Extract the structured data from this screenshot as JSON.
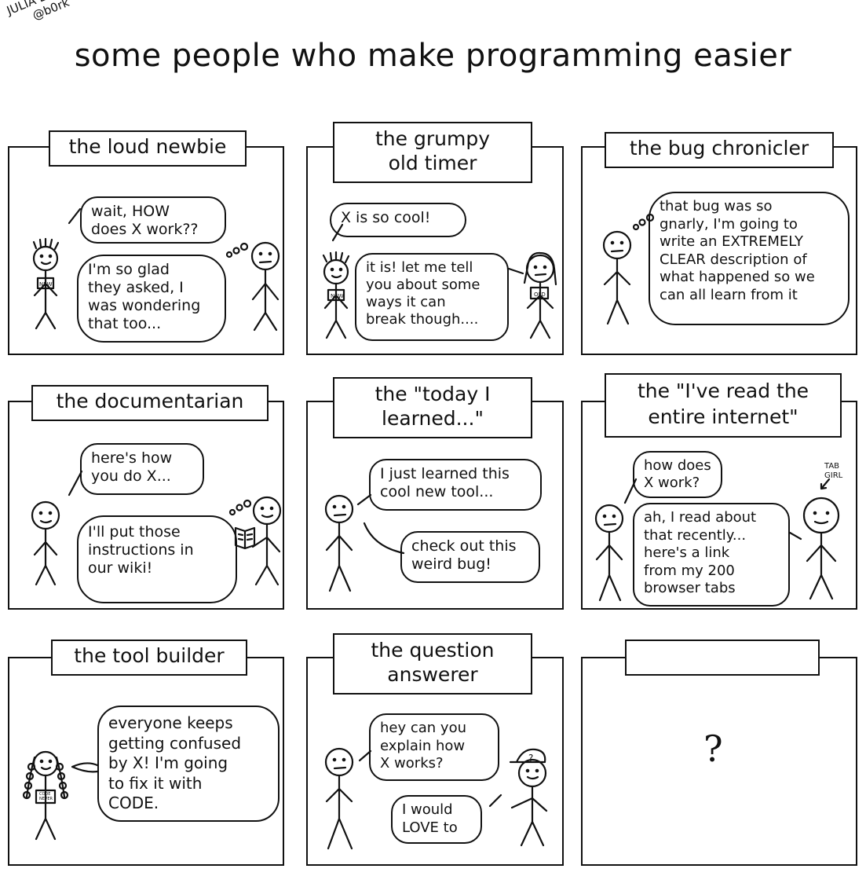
{
  "author": {
    "name": "JULIA EVANS",
    "handle": "@b0rk"
  },
  "title": "some people who make programming easier",
  "panels": [
    {
      "title": "the loud newbie",
      "bubbles": [
        "wait, HOW\ndoes X work??",
        "I'm so glad\nthey asked, I\nwas wondering\nthat too..."
      ],
      "badge": "NEW"
    },
    {
      "title": "the grumpy\nold timer",
      "bubbles": [
        "X is so cool!",
        "it is! let me tell\nyou about some\nways it can\nbreak though...."
      ],
      "badge": "NEW",
      "badge2": "OLD"
    },
    {
      "title": "the bug chronicler",
      "bubbles": [
        "that bug was so\ngnarly, I'm going to\nwrite an EXTREMELY\nCLEAR description of\nwhat happened so we\ncan all learn from it"
      ]
    },
    {
      "title": "the documentarian",
      "bubbles": [
        "here's how\nyou do X...",
        "I'll put those\ninstructions in\nour wiki!"
      ]
    },
    {
      "title": "the \"today I\nlearned...\"",
      "bubbles": [
        "I just learned this\ncool new tool...",
        "check out this\nweird bug!"
      ]
    },
    {
      "title": "the \"I've read the\nentire internet\"",
      "bubbles": [
        "how does\nX work?",
        "ah, I read about\nthat recently...\nhere's a link\nfrom my 200\nbrowser tabs"
      ],
      "tag": "TAB\nGIRL"
    },
    {
      "title": "the tool builder",
      "bubbles": [
        "everyone keeps\ngetting confused\nby X! I'm going\nto fix it with\nCODE."
      ],
      "badge": "CODE\nNEVER"
    },
    {
      "title": "the question\nanswerer",
      "bubbles": [
        "hey can you\nexplain how\nX works?",
        "I would\nLOVE to"
      ]
    },
    {
      "title": "",
      "content": "?"
    }
  ]
}
